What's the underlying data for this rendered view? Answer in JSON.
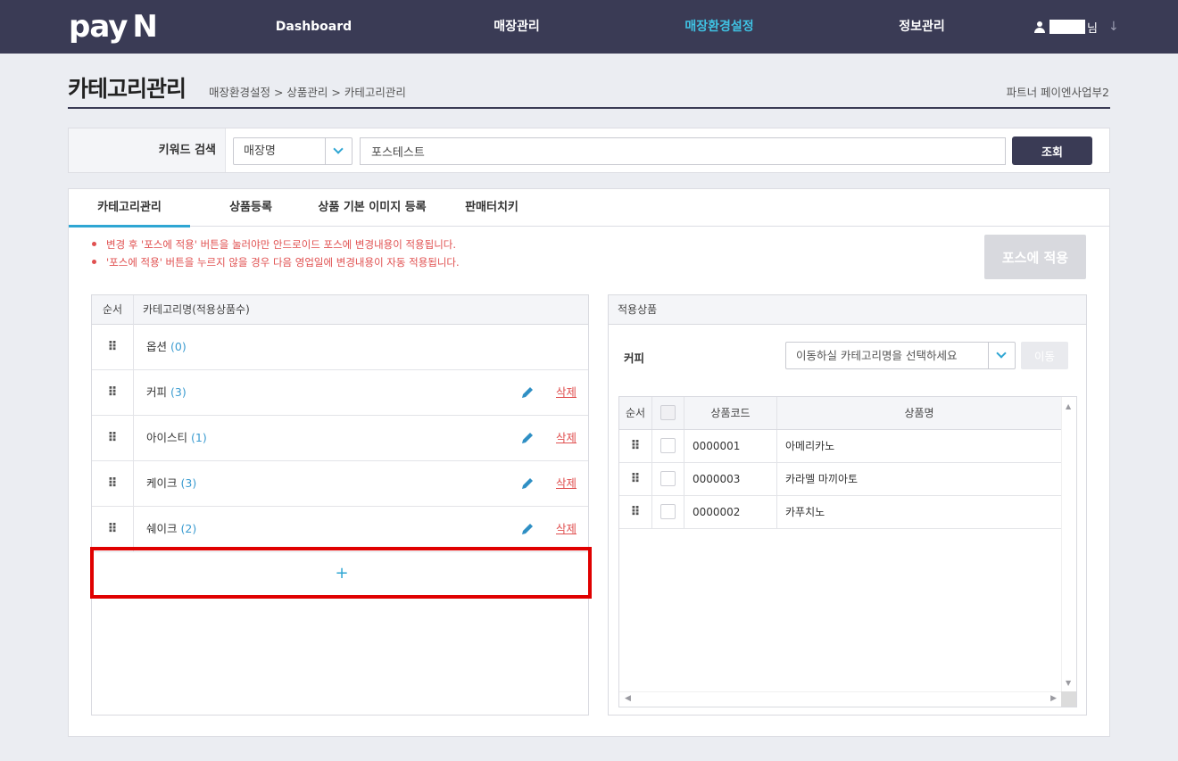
{
  "brand": {
    "logo_text": "pay",
    "logo_mark": "N"
  },
  "nav": {
    "items": [
      {
        "label": "Dashboard"
      },
      {
        "label": "매장관리"
      },
      {
        "label": "매장환경설정"
      },
      {
        "label": "정보관리"
      }
    ],
    "active_index": 2,
    "user_suffix": "님"
  },
  "page": {
    "title": "카테고리관리",
    "breadcrumb": "매장환경설정 > 상품관리 > 카테고리관리",
    "department": "파트너 페이엔사업부2"
  },
  "search": {
    "label": "키워드 검색",
    "field_select": "매장명",
    "keyword": "포스테스트",
    "button": "조회"
  },
  "tabs": [
    {
      "label": "카테고리관리",
      "active": true
    },
    {
      "label": "상품등록",
      "active": false
    },
    {
      "label": "상품 기본 이미지 등록",
      "active": false
    },
    {
      "label": "판매터치키",
      "active": false
    }
  ],
  "notices": [
    "변경 후 '포스에 적용' 버튼을 눌러야만 안드로이드 포스에 변경내용이 적용됩니다.",
    "'포스에 적용' 버튼을 누르지 않을 경우 다음 영업일에 변경내용이 자동 적용됩니다."
  ],
  "apply_button": "포스에 적용",
  "category_table": {
    "headers": [
      "순서",
      "카테고리명(적용상품수)"
    ],
    "rows": [
      {
        "name": "옵션",
        "count": "(0)",
        "editable": false
      },
      {
        "name": "커피",
        "count": "(3)",
        "editable": true
      },
      {
        "name": "아이스티",
        "count": "(1)",
        "editable": true
      },
      {
        "name": "케이크",
        "count": "(3)",
        "editable": true
      },
      {
        "name": "쉐이크",
        "count": "(2)",
        "editable": true
      }
    ],
    "delete_label": "삭제",
    "add_label": "+"
  },
  "product_panel": {
    "title": "적용상품",
    "selected_category": "커피",
    "move_placeholder": "이동하실 카테고리명을 선택하세요",
    "move_button": "이동",
    "headers": [
      "순서",
      "",
      "상품코드",
      "상품명"
    ],
    "rows": [
      {
        "code": "0000001",
        "name": "아메리카노"
      },
      {
        "code": "0000003",
        "name": "카라멜 마끼아토"
      },
      {
        "code": "0000002",
        "name": "카푸치노"
      }
    ]
  },
  "colors": {
    "nav_bg": "#3a3b55",
    "accent": "#2fa6d3",
    "danger": "#e05050",
    "highlight": "#e00000"
  }
}
